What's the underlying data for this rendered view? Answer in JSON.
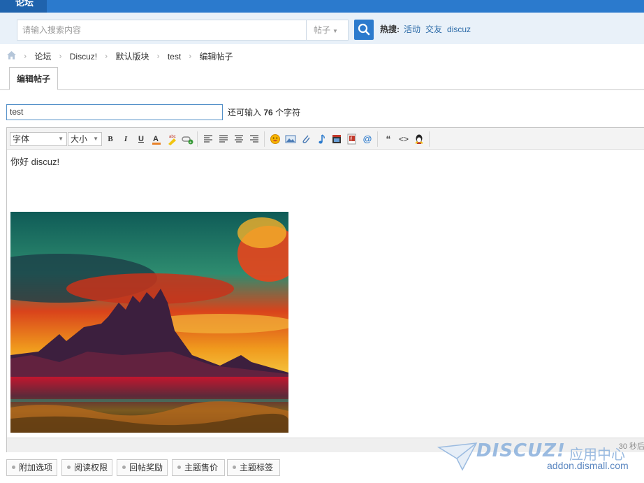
{
  "topnav": {
    "tab_label": "论坛"
  },
  "search": {
    "placeholder": "请输入搜索内容",
    "type_selected": "帖子",
    "hot_label": "热搜:",
    "hot_links": [
      "活动",
      "交友",
      "discuz"
    ]
  },
  "breadcrumb": [
    "论坛",
    "Discuz!",
    "默认版块",
    "test",
    "编辑帖子"
  ],
  "tabs": {
    "active": "编辑帖子"
  },
  "post": {
    "title_value": "test",
    "remain_prefix": "还可输入",
    "remain_count": "76",
    "remain_suffix": "个字符"
  },
  "editor": {
    "font_select": "字体",
    "size_select": "大小",
    "body_text": "你好 discuz!",
    "autosave_text": "30 秒后"
  },
  "options": [
    "附加选项",
    "阅读权限",
    "回帖奖励",
    "主题售价",
    "主题标签"
  ],
  "watermark": {
    "brand": "DISCUZ!",
    "suffix": "应用中心",
    "domain": "addon.dismall.com"
  }
}
